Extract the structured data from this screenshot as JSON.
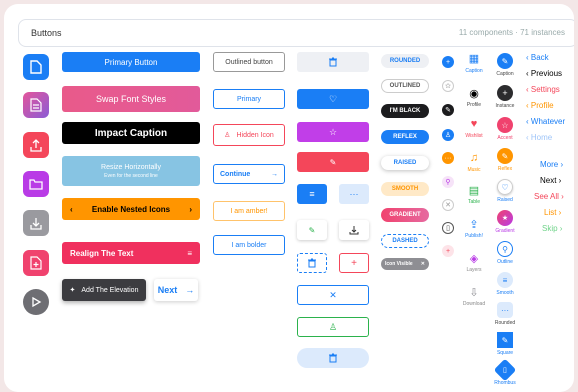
{
  "header": {
    "title": "Buttons",
    "count": "11 components · 71 instances"
  },
  "col2": {
    "primary": "Primary Button",
    "swap": "Swap Font Styles",
    "impact": "Impact Caption",
    "resize": "Resize Horizontally",
    "resize_sub": "Even for the second line",
    "nested": "Enable Nested Icons",
    "realign": "Realign The Text",
    "elevation": "Add The Elevation",
    "next": "Next"
  },
  "col3": {
    "outlined": "Outlined button",
    "primary": "Primary",
    "hidden": "Hidden Icon",
    "continue": "Continue",
    "amber": "I am amber!",
    "bolder": "I am bolder"
  },
  "col5": [
    "ROUNDED",
    "OUTLINED",
    "I'M BLACK",
    "REFLEX",
    "RAISED",
    "SMOOTH",
    "GRADIENT",
    "DASHED"
  ],
  "col5_chip": "Icon Visible",
  "col7_labels": {
    "caption": "Caption",
    "profile": "Profile",
    "wishlist": "Wishlist",
    "music": "Music",
    "table": "Table",
    "publish": "Publish!",
    "layers": "Layers",
    "download": "Download"
  },
  "col8_labels": {
    "caption": "Caption",
    "instance": "Instance",
    "accent": "Accent",
    "reflex": "Reflex",
    "raised": "Raised",
    "gradient": "Gradient",
    "outline": "Outline",
    "smooth": "Smooth",
    "rounded": "Rounded",
    "square": "Square",
    "rhombus": "Rhombus"
  },
  "nav_left": [
    "Back",
    "Previous",
    "Settings",
    "Profile",
    "Whatever",
    "Home"
  ],
  "nav_right": [
    "More",
    "Next",
    "See All",
    "List",
    "Skip"
  ],
  "colors": {
    "blue": "#1a7ef5",
    "pink": "#f0426e",
    "purple": "#b93be6",
    "orange": "#ff9500",
    "red": "#f4465a",
    "grey": "#8e8e93"
  }
}
